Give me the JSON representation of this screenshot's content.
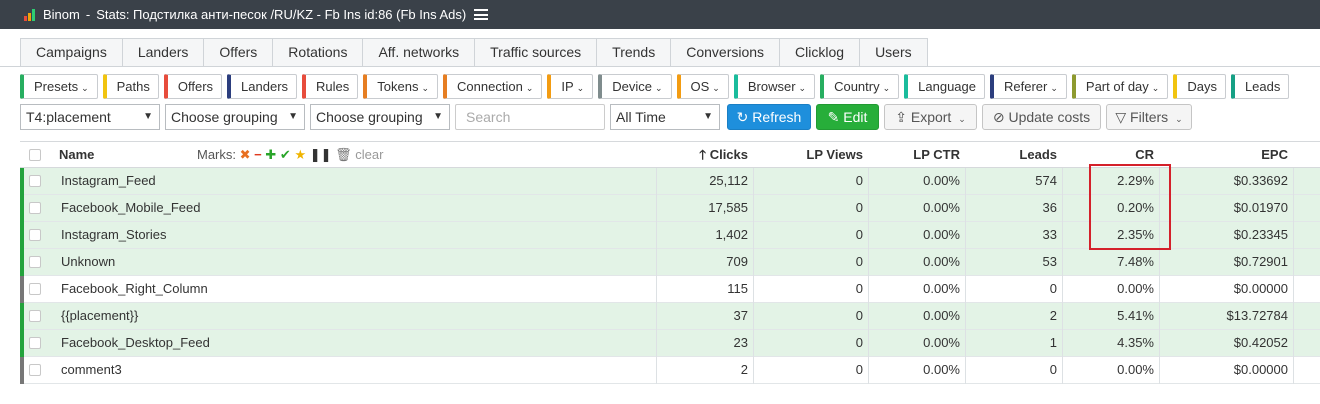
{
  "window": {
    "brand": "Binom",
    "separator": "-",
    "title": "Stats: Подстилка анти-песок /RU/KZ - Fb Ins id:86 (Fb Ins Ads)"
  },
  "nav_tabs": [
    "Campaigns",
    "Landers",
    "Offers",
    "Rotations",
    "Aff. networks",
    "Traffic sources",
    "Trends",
    "Conversions",
    "Clicklog",
    "Users"
  ],
  "chips": [
    {
      "label": "Presets",
      "caret": true,
      "color": "#27ae60"
    },
    {
      "label": "Paths",
      "caret": false,
      "color": "#f1c40f"
    },
    {
      "label": "Offers",
      "caret": false,
      "color": "#e74c3c"
    },
    {
      "label": "Landers",
      "caret": false,
      "color": "#2c3e7e"
    },
    {
      "label": "Rules",
      "caret": false,
      "color": "#e74c3c"
    },
    {
      "label": "Tokens",
      "caret": true,
      "color": "#e67e22"
    },
    {
      "label": "Connection",
      "caret": true,
      "color": "#e67e22"
    },
    {
      "label": "IP",
      "caret": true,
      "color": "#f39c12"
    },
    {
      "label": "Device",
      "caret": true,
      "color": "#7f8c8d"
    },
    {
      "label": "OS",
      "caret": true,
      "color": "#f39c12"
    },
    {
      "label": "Browser",
      "caret": true,
      "color": "#1abc9c"
    },
    {
      "label": "Country",
      "caret": true,
      "color": "#27ae60"
    },
    {
      "label": "Language",
      "caret": false,
      "color": "#1abc9c"
    },
    {
      "label": "Referer",
      "caret": true,
      "color": "#2c3e7e"
    },
    {
      "label": "Part of day",
      "caret": true,
      "color": "#8e9a2f"
    },
    {
      "label": "Days",
      "caret": false,
      "color": "#f1c40f"
    },
    {
      "label": "Leads",
      "caret": false,
      "color": "#16a085"
    }
  ],
  "controls": {
    "grouping1": "T4:placement",
    "grouping2": "Choose grouping",
    "grouping3": "Choose grouping",
    "search_placeholder": "Search",
    "period": "All Time",
    "refresh": "Refresh",
    "edit": "Edit",
    "export": "Export",
    "update_costs": "Update costs",
    "filters": "Filters"
  },
  "table": {
    "headers": {
      "name": "Name",
      "marks": "Marks:",
      "clear": "clear",
      "clicks": "Clicks",
      "lp_views": "LP Views",
      "lp_ctr": "LP CTR",
      "leads": "Leads",
      "cr": "CR",
      "epc": "EPC"
    },
    "sort": {
      "column": "clicks",
      "direction": "up"
    },
    "rows": [
      {
        "name": "Instagram_Feed",
        "clicks": "25,112",
        "lp_views": "0",
        "lp_ctr": "0.00%",
        "leads": "574",
        "cr": "2.29%",
        "epc": "$0.33692",
        "status": "green"
      },
      {
        "name": "Facebook_Mobile_Feed",
        "clicks": "17,585",
        "lp_views": "0",
        "lp_ctr": "0.00%",
        "leads": "36",
        "cr": "0.20%",
        "epc": "$0.01970",
        "status": "green"
      },
      {
        "name": "Instagram_Stories",
        "clicks": "1,402",
        "lp_views": "0",
        "lp_ctr": "0.00%",
        "leads": "33",
        "cr": "2.35%",
        "epc": "$0.23345",
        "status": "green"
      },
      {
        "name": "Unknown",
        "clicks": "709",
        "lp_views": "0",
        "lp_ctr": "0.00%",
        "leads": "53",
        "cr": "7.48%",
        "epc": "$0.72901",
        "status": "green"
      },
      {
        "name": "Facebook_Right_Column",
        "clicks": "115",
        "lp_views": "0",
        "lp_ctr": "0.00%",
        "leads": "0",
        "cr": "0.00%",
        "epc": "$0.00000",
        "status": "neutral"
      },
      {
        "name": "{{placement}}",
        "clicks": "37",
        "lp_views": "0",
        "lp_ctr": "0.00%",
        "leads": "2",
        "cr": "5.41%",
        "epc": "$13.72784",
        "status": "green"
      },
      {
        "name": "Facebook_Desktop_Feed",
        "clicks": "23",
        "lp_views": "0",
        "lp_ctr": "0.00%",
        "leads": "1",
        "cr": "4.35%",
        "epc": "$0.42052",
        "status": "green"
      },
      {
        "name": "comment3",
        "clicks": "2",
        "lp_views": "0",
        "lp_ctr": "0.00%",
        "leads": "0",
        "cr": "0.00%",
        "epc": "$0.00000",
        "status": "neutral"
      }
    ]
  },
  "colors": {
    "titlebar": "#3a4149",
    "row_green": "#e3f3e6",
    "status_green": "#23a33c",
    "highlight": "#d4202a",
    "refresh_button": "#1e8fdc",
    "edit_button": "#27ae3a"
  }
}
